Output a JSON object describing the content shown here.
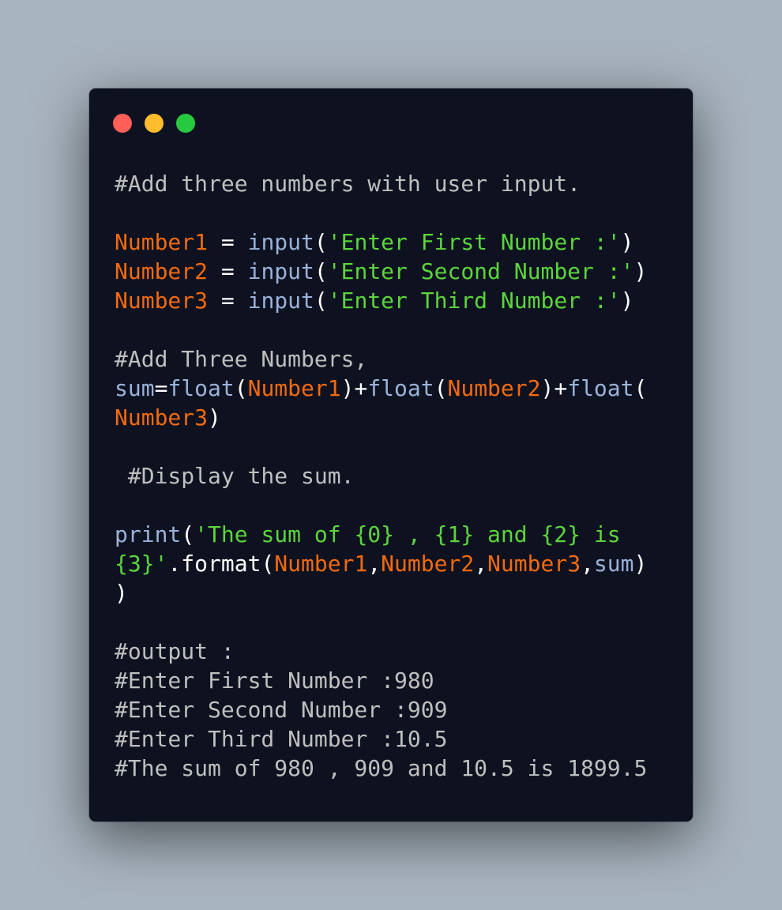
{
  "window": {
    "buttons": [
      "close",
      "minimize",
      "maximize"
    ],
    "colors": {
      "close": "#ff5f56",
      "minimize": "#ffbd2e",
      "maximize": "#27c93f",
      "background": "#0e1220"
    }
  },
  "code": {
    "lines": [
      [
        {
          "t": "c",
          "v": "#Add three numbers with user input."
        }
      ],
      [],
      [
        {
          "t": "v",
          "v": "Number1"
        },
        {
          "t": "p",
          "v": " = "
        },
        {
          "t": "f",
          "v": "input"
        },
        {
          "t": "p",
          "v": "("
        },
        {
          "t": "s",
          "v": "'Enter First Number :'"
        },
        {
          "t": "p",
          "v": ")"
        }
      ],
      [
        {
          "t": "v",
          "v": "Number2"
        },
        {
          "t": "p",
          "v": " = "
        },
        {
          "t": "f",
          "v": "input"
        },
        {
          "t": "p",
          "v": "("
        },
        {
          "t": "s",
          "v": "'Enter Second Number :'"
        },
        {
          "t": "p",
          "v": ")"
        }
      ],
      [
        {
          "t": "v",
          "v": "Number3"
        },
        {
          "t": "p",
          "v": " = "
        },
        {
          "t": "f",
          "v": "input"
        },
        {
          "t": "p",
          "v": "("
        },
        {
          "t": "s",
          "v": "'Enter Third Number :'"
        },
        {
          "t": "p",
          "v": ")"
        }
      ],
      [],
      [
        {
          "t": "c",
          "v": "#Add Three Numbers,"
        }
      ],
      [
        {
          "t": "f",
          "v": "sum"
        },
        {
          "t": "p",
          "v": "="
        },
        {
          "t": "f",
          "v": "float"
        },
        {
          "t": "p",
          "v": "("
        },
        {
          "t": "v",
          "v": "Number1"
        },
        {
          "t": "p",
          "v": ")+"
        },
        {
          "t": "f",
          "v": "float"
        },
        {
          "t": "p",
          "v": "("
        },
        {
          "t": "v",
          "v": "Number2"
        },
        {
          "t": "p",
          "v": ")+"
        },
        {
          "t": "f",
          "v": "float"
        },
        {
          "t": "p",
          "v": "("
        }
      ],
      [
        {
          "t": "v",
          "v": "Number3"
        },
        {
          "t": "p",
          "v": ")"
        }
      ],
      [],
      [
        {
          "t": "c",
          "v": " #Display the sum."
        }
      ],
      [],
      [
        {
          "t": "f",
          "v": "print"
        },
        {
          "t": "p",
          "v": "("
        },
        {
          "t": "s",
          "v": "'The sum of {0} , {1} and {2} is"
        }
      ],
      [
        {
          "t": "s",
          "v": "{3}'"
        },
        {
          "t": "p",
          "v": ".format("
        },
        {
          "t": "v",
          "v": "Number1"
        },
        {
          "t": "p",
          "v": ","
        },
        {
          "t": "v",
          "v": "Number2"
        },
        {
          "t": "p",
          "v": ","
        },
        {
          "t": "v",
          "v": "Number3"
        },
        {
          "t": "p",
          "v": ","
        },
        {
          "t": "f",
          "v": "sum"
        },
        {
          "t": "p",
          "v": ")"
        }
      ],
      [
        {
          "t": "p",
          "v": ")"
        }
      ],
      [],
      [
        {
          "t": "c",
          "v": "#output :"
        }
      ],
      [
        {
          "t": "c",
          "v": "#Enter First Number :980"
        }
      ],
      [
        {
          "t": "c",
          "v": "#Enter Second Number :909"
        }
      ],
      [
        {
          "t": "c",
          "v": "#Enter Third Number :10.5"
        }
      ],
      [
        {
          "t": "c",
          "v": "#The sum of 980 , 909 and 10.5 is 1899.5"
        }
      ]
    ]
  }
}
